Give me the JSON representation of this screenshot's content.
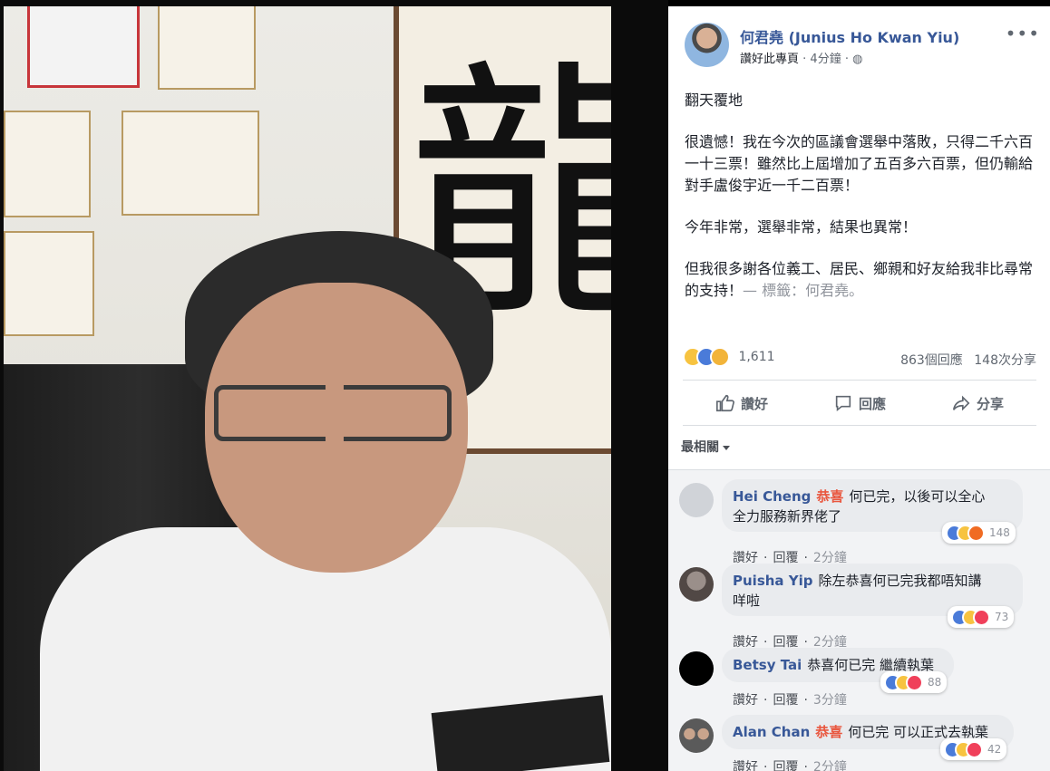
{
  "post": {
    "author": "何君堯 (Junius Ho Kwan Yiu)",
    "like_page": "讚好此專頁",
    "time": "4分鐘",
    "more": "•••",
    "paragraphs": [
      "翻天覆地",
      "很遺憾！我在今次的區議會選舉中落敗，只得二千六百一十三票！雖然比上屆增加了五百多六百票，但仍輸給對手盧俊宇近一千二百票！",
      "今年非常，選舉非常，結果也異常！"
    ],
    "last_paragraph": "但我很多謝各位義工、居民、鄉親和好友給我非比尋常的支持！",
    "tag_prefix": "— 標籤：",
    "tag_name": "何君堯",
    "tag_suffix": "。",
    "reactions_count": "1,611",
    "comments_count": "863個回應",
    "shares_count": "148次分享",
    "action_like": "讚好",
    "action_comment": "回應",
    "action_share": "分享",
    "sort_label": "最相關",
    "photo_calligraphy": "龍"
  },
  "comments": [
    {
      "name": "Hei Cheng",
      "tag": "恭喜",
      "text_line1": "何已完，以後可以全心",
      "text_line2": "全力服務新界佬了",
      "like": "讚好",
      "reply": "回覆",
      "time": "2分鐘",
      "reaction_count": "148"
    },
    {
      "name": "Puisha Yip",
      "tag": "",
      "text_line1": "除左恭喜何已完我都唔知講",
      "text_line2": "咩啦",
      "like": "讚好",
      "reply": "回覆",
      "time": "2分鐘",
      "reaction_count": "73"
    },
    {
      "name": "Betsy Tai",
      "tag": "",
      "text_line1": "恭喜何已完 繼續執葉",
      "text_line2": "",
      "like": "讚好",
      "reply": "回覆",
      "time": "3分鐘",
      "reaction_count": "88"
    },
    {
      "name": "Alan Chan",
      "tag": "恭喜",
      "text_line1": "何已完 可以正式去執葉",
      "text_line2": "",
      "like": "讚好",
      "reply": "回覆",
      "time": "2分鐘",
      "reaction_count": "42"
    }
  ],
  "colors": {
    "link": "#385898",
    "tag_highlight": "#e9573f",
    "muted": "#90949c"
  }
}
